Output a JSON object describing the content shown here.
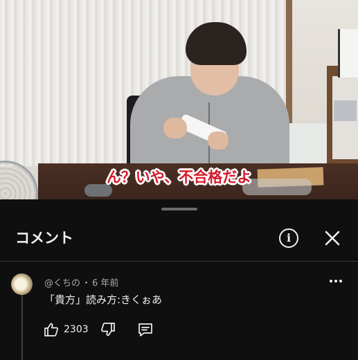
{
  "video": {
    "subtitle": "ん？いや、不合格だよ"
  },
  "sheet": {
    "title": "コメント",
    "info_icon": "info-icon",
    "close_icon": "close-icon"
  },
  "comments": [
    {
      "author": "@くちの",
      "separator": "・",
      "age": "6 年前",
      "text": "「貴方」読み方:きくぉあ",
      "likes": "2303",
      "icons": [
        "thumbs-up-icon",
        "thumbs-down-icon",
        "reply-icon",
        "more-icon"
      ]
    }
  ],
  "colors": {
    "background": "#0f0f0f",
    "text": "#f1f1f1",
    "muted": "#aaaaaa",
    "subtitle": "#d4192b"
  }
}
